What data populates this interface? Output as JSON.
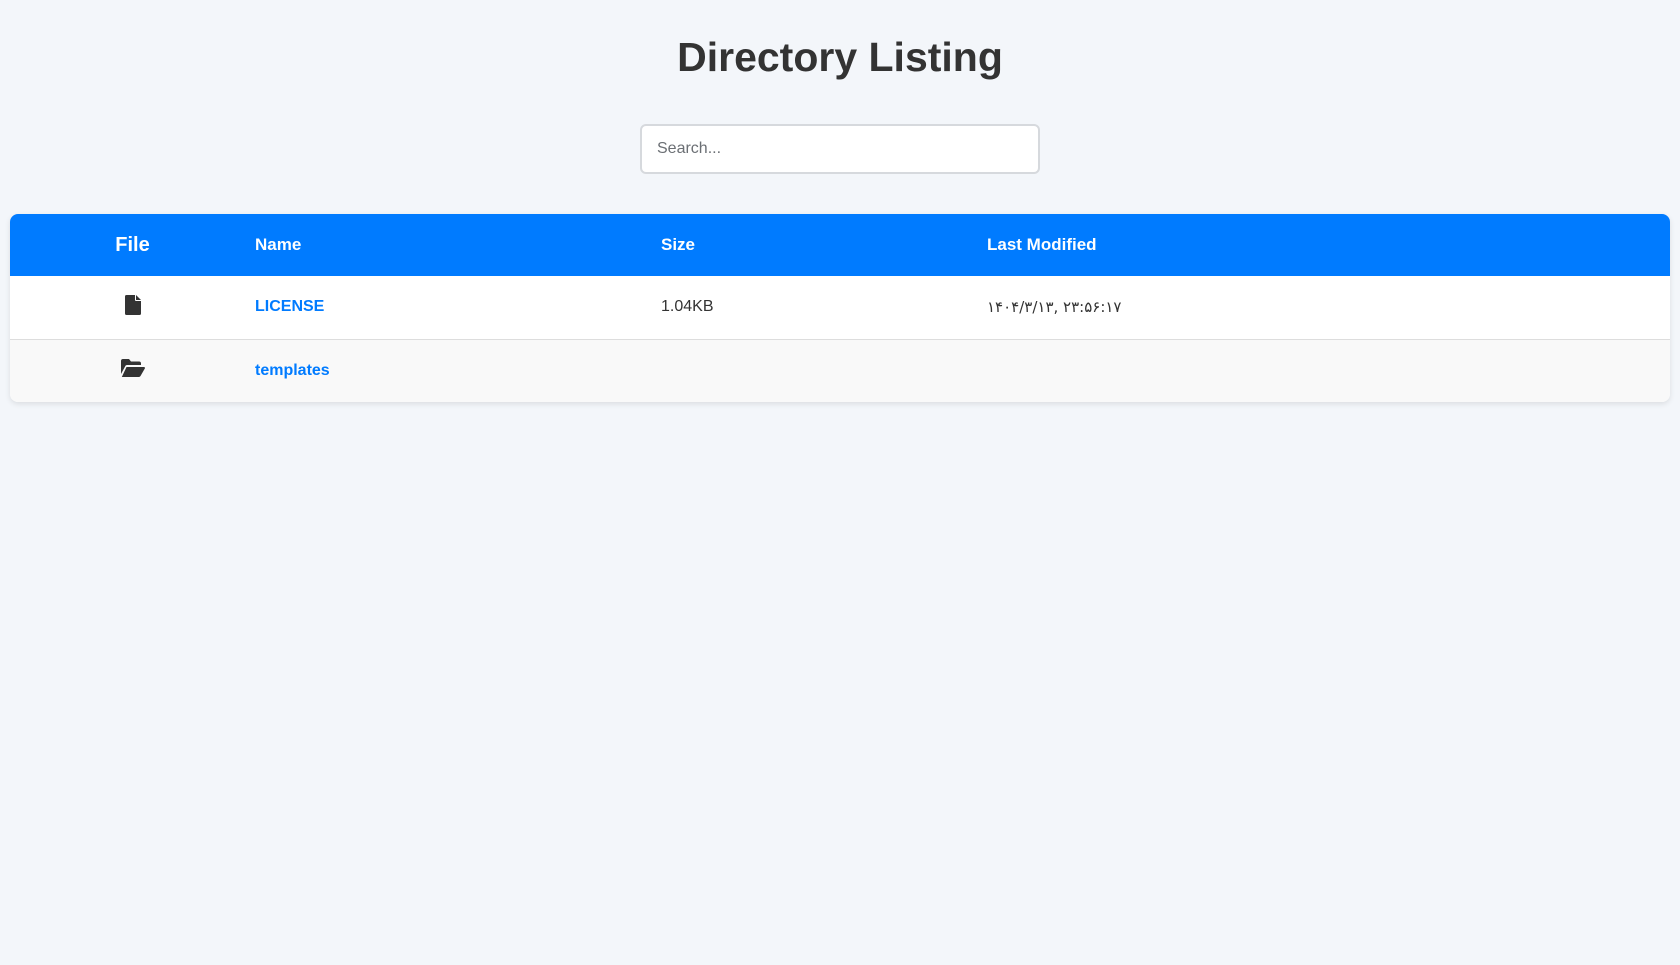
{
  "page": {
    "title": "Directory Listing"
  },
  "search": {
    "placeholder": "Search...",
    "value": ""
  },
  "table": {
    "headers": {
      "file": "File",
      "name": "Name",
      "size": "Size",
      "modified": "Last Modified"
    },
    "rows": [
      {
        "icon": "file-icon",
        "name": "LICENSE",
        "size": "1.04KB",
        "modified": "۱۴۰۴/۳/۱۳, ۲۳:۵۶:۱۷"
      },
      {
        "icon": "folder-open-icon",
        "name": "templates",
        "size": "",
        "modified": ""
      }
    ]
  },
  "colors": {
    "header_bg": "#007bff",
    "link": "#007bff",
    "page_bg": "#f3f6fa",
    "text": "#333333"
  }
}
